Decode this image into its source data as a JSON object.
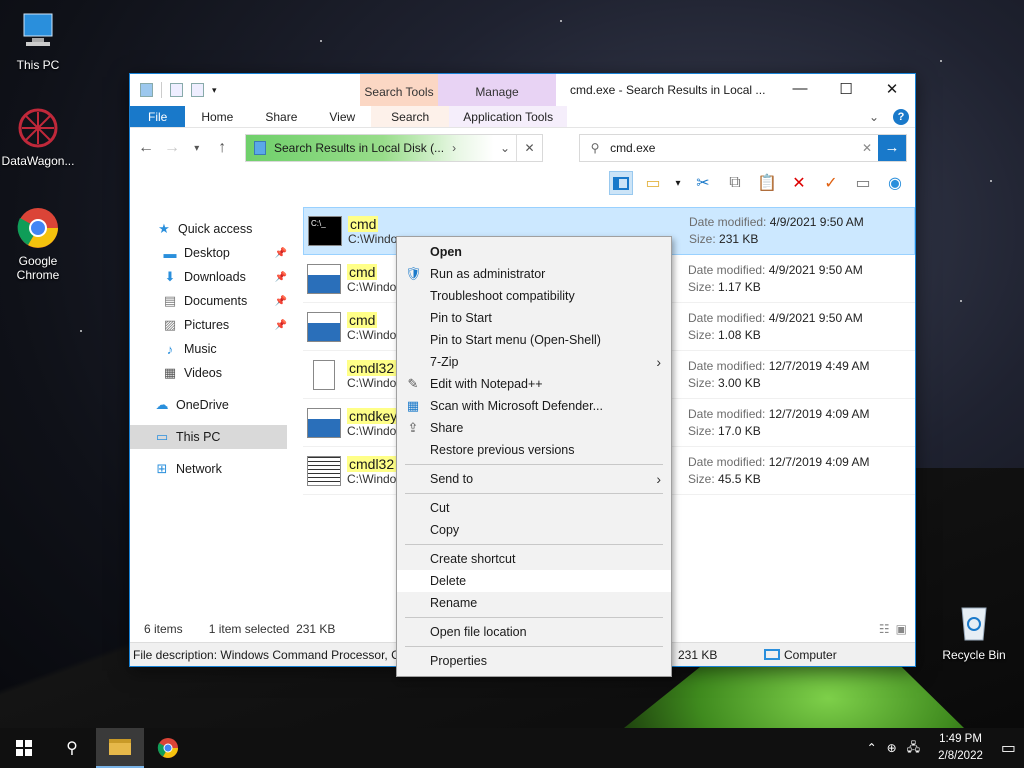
{
  "desktop": {
    "icons": [
      {
        "label": "This PC"
      },
      {
        "label": "DataWagon..."
      },
      {
        "label": "Google Chrome"
      },
      {
        "label": "Recycle Bin"
      }
    ]
  },
  "window": {
    "title": "cmd.exe - Search Results in Local ...",
    "context_tabs": {
      "search_tools": "Search Tools",
      "manage": "Manage"
    },
    "ribbon_tabs": [
      "File",
      "Home",
      "Share",
      "View",
      "Search",
      "Application Tools"
    ],
    "address": {
      "breadcrumb": "Search Results in Local Disk (...",
      "sep": "›"
    },
    "search": {
      "value": "cmd.exe"
    },
    "accent": "#1979ca"
  },
  "nav_pane": {
    "items": [
      {
        "label": "Quick access",
        "icon": "star-icon"
      },
      {
        "label": "Desktop",
        "icon": "desktop-folder-icon",
        "pinned": true
      },
      {
        "label": "Downloads",
        "icon": "download-icon",
        "pinned": true
      },
      {
        "label": "Documents",
        "icon": "document-icon",
        "pinned": true
      },
      {
        "label": "Pictures",
        "icon": "picture-icon",
        "pinned": true
      },
      {
        "label": "Music",
        "icon": "music-icon"
      },
      {
        "label": "Videos",
        "icon": "video-icon"
      },
      {
        "label": "OneDrive",
        "icon": "cloud-icon"
      },
      {
        "label": "This PC",
        "icon": "computer-icon"
      },
      {
        "label": "Network",
        "icon": "network-icon"
      }
    ]
  },
  "files": [
    {
      "name": "cmd",
      "path": "C:\\Windo",
      "date_label": "Date modified:",
      "date": "4/9/2021 9:50 AM",
      "size_label": "Size:",
      "size": "231 KB"
    },
    {
      "name": "cmd",
      "path": "C:\\Windo",
      "date_label": "Date modified:",
      "date": "4/9/2021 9:50 AM",
      "size_label": "Size:",
      "size": "1.17 KB"
    },
    {
      "name": "cmd",
      "path": "C:\\Windo",
      "date_label": "Date modified:",
      "date": "4/9/2021 9:50 AM",
      "size_label": "Size:",
      "size": "1.08 KB"
    },
    {
      "name": "cmdl32",
      "path": "C:\\Windo",
      "date_label": "Date modified:",
      "date": "12/7/2019 4:49 AM",
      "size_label": "Size:",
      "size": "3.00 KB"
    },
    {
      "name": "cmdkey",
      "path": "C:\\Windo",
      "date_label": "Date modified:",
      "date": "12/7/2019 4:09 AM",
      "size_label": "Size:",
      "size": "17.0 KB"
    },
    {
      "name": "cmdl32",
      "path": "C:\\Windo",
      "date_label": "Date modified:",
      "date": "12/7/2019 4:09 AM",
      "size_label": "Size:",
      "size": "45.5 KB"
    }
  ],
  "status": {
    "count": "6 items",
    "selection": "1 item selected  231 KB",
    "description": "File description: Windows Command Processor, C",
    "desc_size": "231 KB",
    "location": "Computer"
  },
  "context_menu": {
    "items": [
      {
        "label": "Open",
        "bold": true
      },
      {
        "label": "Run as administrator",
        "icon": "shield-icon"
      },
      {
        "label": "Troubleshoot compatibility"
      },
      {
        "label": "Pin to Start"
      },
      {
        "label": "Pin to Start menu (Open-Shell)"
      },
      {
        "label": "7-Zip",
        "submenu": true
      },
      {
        "label": "Edit with Notepad++",
        "icon": "notepad-plus-icon"
      },
      {
        "label": "Scan with Microsoft Defender...",
        "icon": "defender-icon"
      },
      {
        "label": "Share",
        "icon": "share-icon"
      },
      {
        "label": "Restore previous versions"
      },
      {
        "sep": true
      },
      {
        "label": "Send to",
        "submenu": true
      },
      {
        "sep": true
      },
      {
        "label": "Cut"
      },
      {
        "label": "Copy"
      },
      {
        "sep": true
      },
      {
        "label": "Create shortcut"
      },
      {
        "label": "Delete",
        "highlight": true
      },
      {
        "label": "Rename"
      },
      {
        "sep": true
      },
      {
        "label": "Open file location"
      },
      {
        "sep": true
      },
      {
        "label": "Properties"
      }
    ]
  },
  "taskbar": {
    "time": "1:49 PM",
    "date": "2/8/2022"
  }
}
